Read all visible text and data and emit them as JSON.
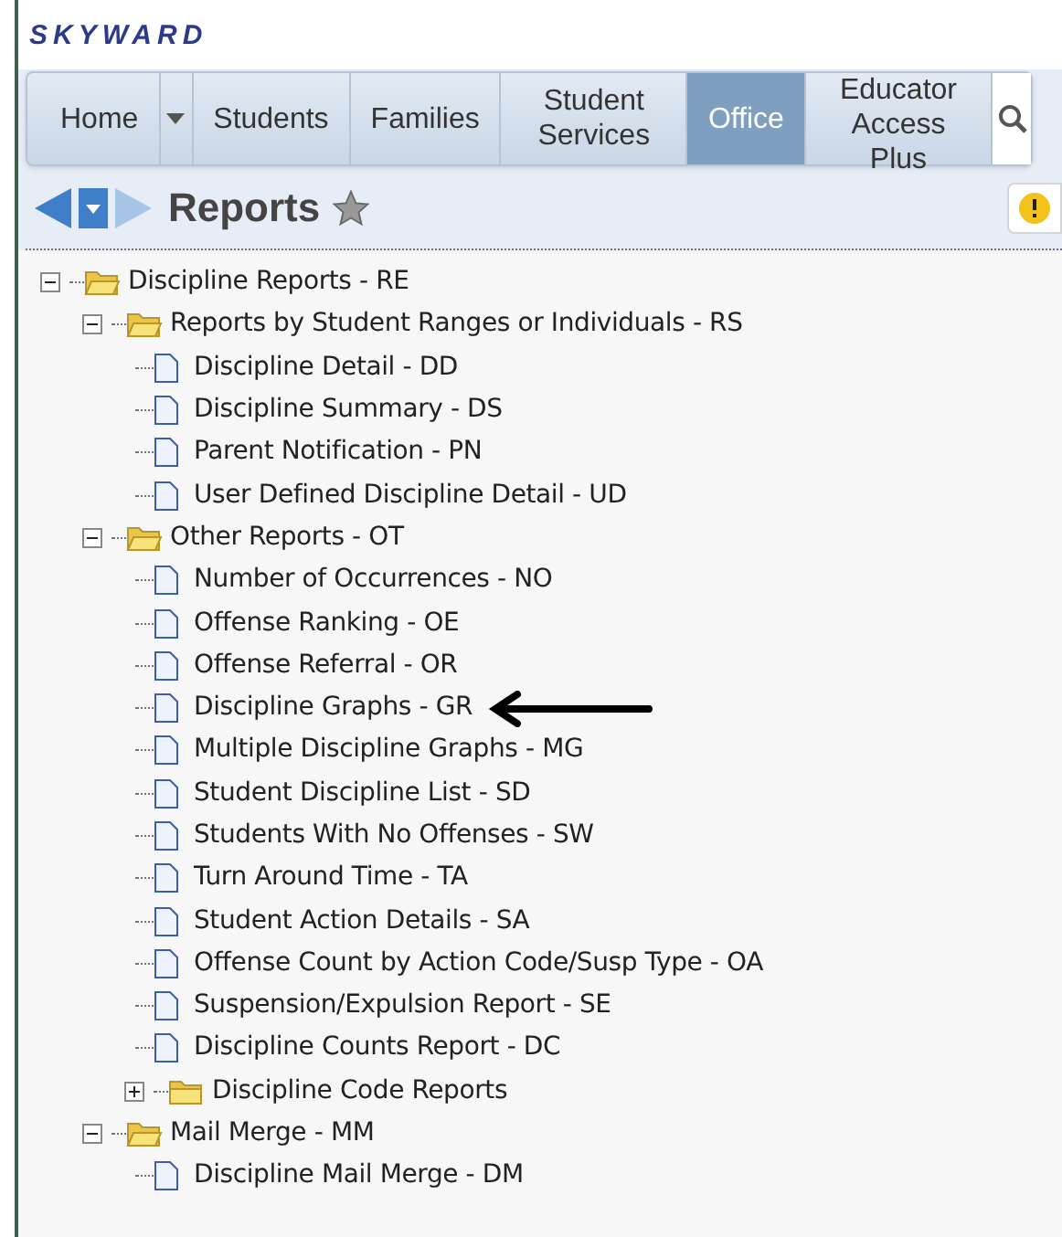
{
  "logo": "SKYWARD",
  "nav": [
    {
      "label": "Home",
      "selected": false,
      "kind": "tab"
    },
    {
      "kind": "dropdown",
      "selected": false
    },
    {
      "label": "Students",
      "selected": false,
      "kind": "tab"
    },
    {
      "label": "Families",
      "selected": false,
      "kind": "tab"
    },
    {
      "label": "Student Services",
      "selected": false,
      "kind": "tab"
    },
    {
      "label": "Office",
      "selected": true,
      "kind": "tab"
    },
    {
      "label": "Educator Access Plus",
      "selected": false,
      "kind": "tab"
    },
    {
      "kind": "search",
      "selected": false
    }
  ],
  "page_title": "Reports",
  "tree": [
    {
      "label": "Discipline Reports - RE",
      "kind": "folder",
      "expanded": true,
      "children": [
        {
          "label": "Reports by Student Ranges or Individuals - RS",
          "kind": "folder",
          "expanded": true,
          "children": [
            {
              "label": "Discipline Detail - DD",
              "kind": "report"
            },
            {
              "label": "Discipline Summary - DS",
              "kind": "report"
            },
            {
              "label": "Parent Notification - PN",
              "kind": "report"
            },
            {
              "label": "User Defined Discipline Detail - UD",
              "kind": "report"
            }
          ]
        },
        {
          "label": "Other Reports - OT",
          "kind": "folder",
          "expanded": true,
          "children": [
            {
              "label": "Number of Occurrences - NO",
              "kind": "report"
            },
            {
              "label": "Offense Ranking - OE",
              "kind": "report"
            },
            {
              "label": "Offense Referral - OR",
              "kind": "report"
            },
            {
              "label": "Discipline Graphs - GR",
              "kind": "report",
              "marked": true
            },
            {
              "label": "Multiple Discipline Graphs - MG",
              "kind": "report"
            },
            {
              "label": "Student Discipline List - SD",
              "kind": "report"
            },
            {
              "label": "Students With No Offenses - SW",
              "kind": "report"
            },
            {
              "label": "Turn Around Time - TA",
              "kind": "report"
            },
            {
              "label": "Student Action Details - SA",
              "kind": "report"
            },
            {
              "label": "Offense Count by Action Code/Susp Type - OA",
              "kind": "report"
            },
            {
              "label": "Suspension/Expulsion Report - SE",
              "kind": "report"
            },
            {
              "label": "Discipline Counts Report - DC",
              "kind": "report"
            },
            {
              "label": "Discipline Code Reports",
              "kind": "folder",
              "expanded": false
            }
          ]
        },
        {
          "label": "Mail Merge - MM",
          "kind": "folder",
          "expanded": true,
          "children": [
            {
              "label": "Discipline Mail Merge - DM",
              "kind": "report"
            }
          ]
        }
      ]
    }
  ]
}
